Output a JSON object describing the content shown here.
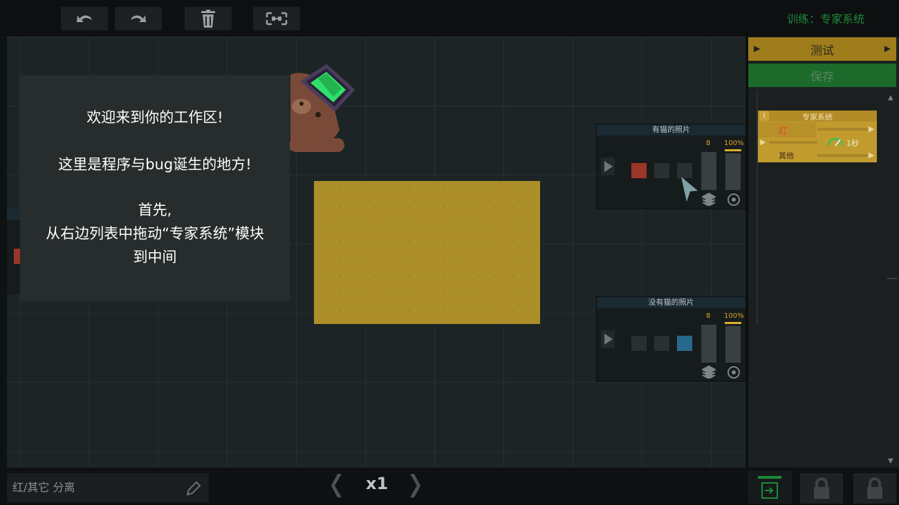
{
  "toolbar": {
    "undo_icon": "undo-icon",
    "redo_icon": "redo-icon",
    "delete_icon": "trash-icon",
    "fit_icon": "fit-view-icon",
    "title": "训练：专家系统"
  },
  "dialog": {
    "line1": "欢迎来到你的工作区!",
    "line2": "这里是程序与bug诞生的地方!",
    "line3": "首先,",
    "line4": "从右边列表中拖动“专家系统”模块",
    "line5": "到中间"
  },
  "nodes": [
    {
      "title": "有猫的照片",
      "count": "8",
      "percent": "100%",
      "cells": [
        "#9b3628",
        "#2a2f30",
        "#2a2f30"
      ]
    },
    {
      "title": "没有猫的照片",
      "count": "8",
      "percent": "100%",
      "cells": [
        "#2a2f30",
        "#2a2f30",
        "#27698a"
      ]
    }
  ],
  "side": {
    "test_label": "测试",
    "save_label": "保存",
    "module": {
      "info": "i",
      "title": "专家系统",
      "out1": "红",
      "out2": "其他",
      "timer": "1秒"
    }
  },
  "bottom": {
    "name_value": "红/其它 分离",
    "speed": "x1"
  },
  "colors": {
    "accent_yellow": "#ad8f2a",
    "save_green": "#1c6b2a",
    "title_green": "#1f8a3a"
  }
}
